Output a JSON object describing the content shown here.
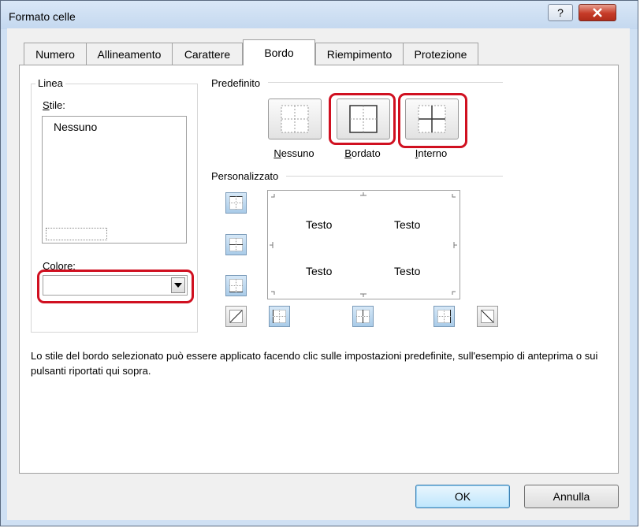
{
  "window": {
    "title": "Formato celle"
  },
  "titlebar": {
    "help_label": "?"
  },
  "tabs": [
    {
      "label": "Numero"
    },
    {
      "label": "Allineamento"
    },
    {
      "label": "Carattere"
    },
    {
      "label": "Bordo",
      "active": true
    },
    {
      "label": "Riempimento"
    },
    {
      "label": "Protezione"
    }
  ],
  "linea": {
    "legend": "Linea",
    "stile_label_u": "S",
    "stile_label_rest": "tile:",
    "stile_selected": "Nessuno",
    "colore_label_u": "C",
    "colore_label_rest": "olore:"
  },
  "predefinito": {
    "legend": "Predefinito",
    "presets": [
      {
        "u": "N",
        "rest": "essuno"
      },
      {
        "u": "B",
        "rest": "ordato"
      },
      {
        "u": "I",
        "rest": "nterno"
      }
    ]
  },
  "personalizzato": {
    "legend": "Personalizzato",
    "preview_texts": [
      "Testo",
      "Testo",
      "Testo",
      "Testo"
    ]
  },
  "description": "Lo stile del bordo selezionato può essere applicato facendo clic sulle impostazioni predefinite, sull'esempio di anteprima o sui pulsanti riportati qui sopra.",
  "buttons": {
    "ok": "OK",
    "cancel": "Annulla"
  },
  "colors": {
    "highlight": "#d01020",
    "title_bg": "#c4d8ef",
    "close_button": "#c63b28"
  }
}
